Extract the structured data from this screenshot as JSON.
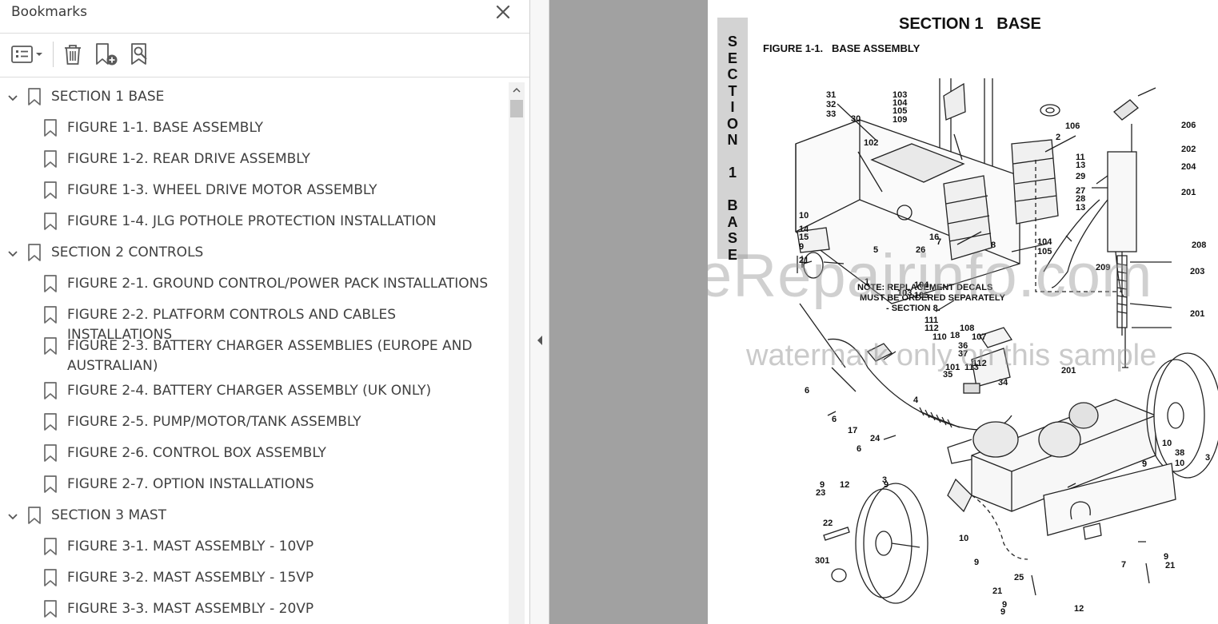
{
  "panel": {
    "title": "Bookmarks"
  },
  "toolbar": {
    "options_icon": "list-options-icon",
    "delete_icon": "trash-icon",
    "add_icon": "new-bookmark-icon",
    "find_icon": "find-bookmark-icon"
  },
  "bookmarks": [
    {
      "level": 0,
      "label": "SECTION 1 BASE",
      "expanded": true
    },
    {
      "level": 1,
      "label": "FIGURE 1-1. BASE ASSEMBLY"
    },
    {
      "level": 1,
      "label": "FIGURE 1-2. REAR DRIVE ASSEMBLY"
    },
    {
      "level": 1,
      "label": "FIGURE 1-3. WHEEL DRIVE MOTOR ASSEMBLY"
    },
    {
      "level": 1,
      "label": "FIGURE 1-4. JLG POTHOLE PROTECTION INSTALLATION"
    },
    {
      "level": 0,
      "label": "SECTION 2 CONTROLS",
      "expanded": true
    },
    {
      "level": 1,
      "label": "FIGURE 2-1. GROUND CONTROL/POWER PACK INSTALLATIONS"
    },
    {
      "level": 1,
      "label": "FIGURE 2-2. PLATFORM CONTROLS AND CABLES INSTALLATIONS"
    },
    {
      "level": 1,
      "label": "FIGURE 2-3. BATTERY CHARGER ASSEMBLIES (EUROPE AND AUSTRALIAN)"
    },
    {
      "level": 1,
      "label": "FIGURE 2-4. BATTERY CHARGER ASSEMBLY (UK ONLY)"
    },
    {
      "level": 1,
      "label": "FIGURE 2-5. PUMP/MOTOR/TANK ASSEMBLY"
    },
    {
      "level": 1,
      "label": "FIGURE 2-6. CONTROL BOX ASSEMBLY"
    },
    {
      "level": 1,
      "label": "FIGURE 2-7. OPTION INSTALLATIONS"
    },
    {
      "level": 0,
      "label": "SECTION 3 MAST",
      "expanded": true
    },
    {
      "level": 1,
      "label": "FIGURE 3-1. MAST ASSEMBLY - 10VP"
    },
    {
      "level": 1,
      "label": "FIGURE 3-2. MAST ASSEMBLY - 15VP"
    },
    {
      "level": 1,
      "label": "FIGURE 3-3. MAST ASSEMBLY - 20VP"
    }
  ],
  "document": {
    "side_tab": "SECTION 1 BASE",
    "section_title": "SECTION 1   BASE",
    "figure_title": "FIGURE 1-1.   BASE ASSEMBLY",
    "note_lines": [
      "NOTE: REPLACEMENT DECALS",
      "MUST BE ORDERED SEPARATELY",
      "- SECTION 8."
    ],
    "callouts": [
      "31",
      "32",
      "33",
      "30",
      "103",
      "104",
      "105",
      "109",
      "102",
      "106",
      "2",
      "11",
      "13",
      "29",
      "27",
      "28",
      "13",
      "206",
      "202",
      "204",
      "201",
      "10",
      "14",
      "15",
      "9",
      "21",
      "5",
      "16",
      "26",
      "7",
      "8",
      "104",
      "105",
      "1",
      "209",
      "208",
      "203",
      "201",
      "104",
      "105",
      "103",
      "111",
      "112",
      "110",
      "108",
      "107",
      "18",
      "36",
      "37",
      "35",
      "101",
      "112",
      "113",
      "201",
      "34",
      "6",
      "6",
      "17",
      "24",
      "4",
      "6",
      "38",
      "10",
      "3",
      "10",
      "9",
      "9",
      "12",
      "9",
      "3",
      "23",
      "22",
      "301",
      "10",
      "9",
      "25",
      "7",
      "9",
      "21",
      "9",
      "21",
      "9",
      "12"
    ],
    "watermark_main": "eRepairinfo.com",
    "watermark_sub": "watermark only on this sample"
  }
}
